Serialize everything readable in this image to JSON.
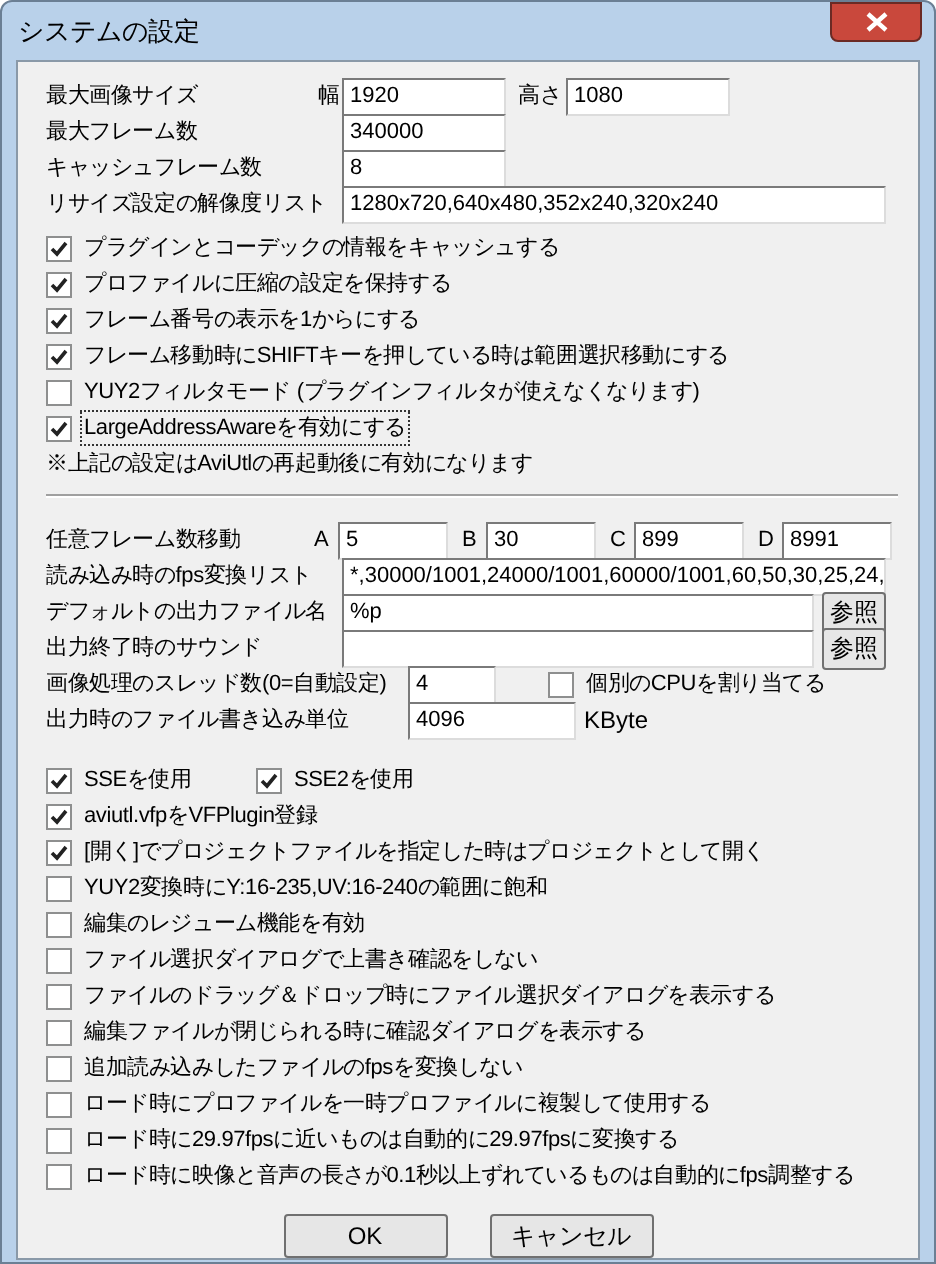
{
  "window": {
    "title": "システムの設定"
  },
  "size_row": {
    "label": "最大画像サイズ",
    "width_label": "幅",
    "width_value": "1920",
    "height_label": "高さ",
    "height_value": "1080"
  },
  "fields": [
    {
      "label": "最大フレーム数",
      "value": "340000",
      "kind": "short"
    },
    {
      "label": "キャッシュフレーム数",
      "value": "8",
      "kind": "short"
    },
    {
      "label": "リサイズ設定の解像度リスト",
      "value": "1280x720,640x480,352x240,320x240",
      "kind": "long"
    }
  ],
  "options_top": [
    {
      "label": "プラグインとコーデックの情報をキャッシュする",
      "checked": true,
      "focused": false
    },
    {
      "label": "プロファイルに圧縮の設定を保持する",
      "checked": true,
      "focused": false
    },
    {
      "label": "フレーム番号の表示を1からにする",
      "checked": true,
      "focused": false
    },
    {
      "label": "フレーム移動時にSHIFTキーを押している時は範囲選択移動にする",
      "checked": true,
      "focused": false
    },
    {
      "label": "YUY2フィルタモード (プラグインフィルタが使えなくなります)",
      "checked": false,
      "focused": false
    },
    {
      "label": "LargeAddressAwareを有効にする",
      "checked": true,
      "focused": true
    }
  ],
  "note": "※上記の設定はAviUtlの再起動後に有効になります",
  "frame_jump": {
    "label": "任意フレーム数移動",
    "fields": [
      {
        "label": "A",
        "value": "5"
      },
      {
        "label": "B",
        "value": "30"
      },
      {
        "label": "C",
        "value": "899"
      },
      {
        "label": "D",
        "value": "8991"
      }
    ]
  },
  "fps_list": {
    "label": "読み込み時のfps変換リスト",
    "value": "*,30000/1001,24000/1001,60000/1001,60,50,30,25,24,"
  },
  "paths": [
    {
      "label": "デフォルトの出力ファイル名",
      "value": "%p",
      "button": "参照"
    },
    {
      "label": "出力終了時のサウンド",
      "button": "参照"
    }
  ],
  "threads": {
    "label": "画像処理のスレッド数(0=自動設定)",
    "value": "4",
    "cpu_label": "個別のCPUを割り当てる",
    "cpu_checked": false
  },
  "write_unit": {
    "label": "出力時のファイル書き込み単位",
    "value": "4096",
    "unit": "KByte"
  },
  "sse": [
    {
      "label": "SSEを使用",
      "checked": true
    },
    {
      "label": "SSE2を使用",
      "checked": true
    }
  ],
  "options_bottom": [
    {
      "label": "aviutl.vfpをVFPlugin登録",
      "checked": true
    },
    {
      "label": "[開く]でプロジェクトファイルを指定した時はプロジェクトとして開く",
      "checked": true
    },
    {
      "label": "YUY2変換時にY:16-235,UV:16-240の範囲に飽和",
      "checked": false
    },
    {
      "label": "編集のレジューム機能を有効",
      "checked": false
    },
    {
      "label": "ファイル選択ダイアログで上書き確認をしない",
      "checked": false
    },
    {
      "label": "ファイルのドラッグ＆ドロップ時にファイル選択ダイアログを表示する",
      "checked": false
    },
    {
      "label": "編集ファイルが閉じられる時に確認ダイアログを表示する",
      "checked": false
    },
    {
      "label": "追加読み込みしたファイルのfpsを変換しない",
      "checked": false
    },
    {
      "label": "ロード時にプロファイルを一時プロファイルに複製して使用する",
      "checked": false
    },
    {
      "label": "ロード時に29.97fpsに近いものは自動的に29.97fpsに変換する",
      "checked": false
    },
    {
      "label": "ロード時に映像と音声の長さが0.1秒以上ずれているものは自動的にfps調整する",
      "checked": false
    }
  ],
  "buttons": [
    "OK",
    "キャンセル"
  ]
}
